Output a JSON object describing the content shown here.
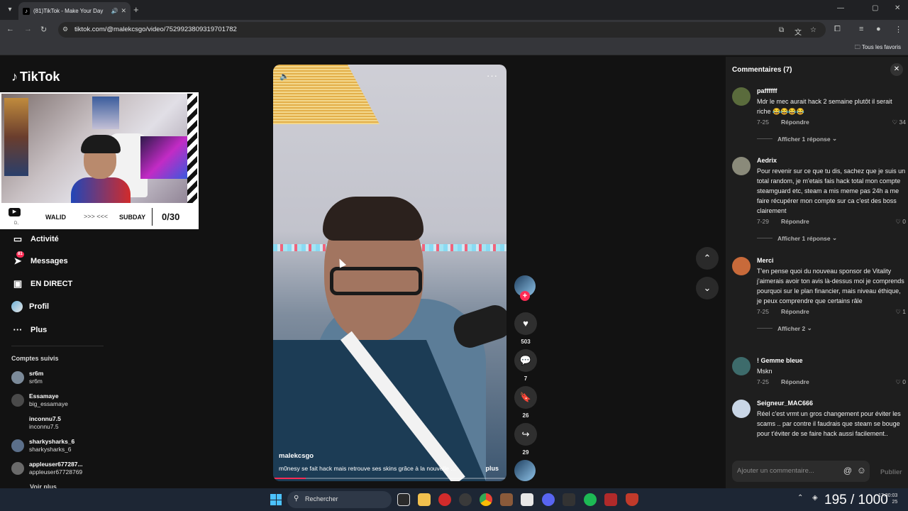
{
  "browser": {
    "tab_title": "(81)TikTok - Make Your Day",
    "url": "tiktok.com/@malekcsgo/video/7529923809319701782",
    "bookmarks_folder": "Tous les favoris"
  },
  "sidebar": {
    "logo": "TikTok",
    "webcam": {
      "player1": "WALID",
      "arrows": ">>> <<<",
      "player2": "SUBDAY",
      "score": "0/30",
      "tiny": "D,"
    },
    "nav": [
      {
        "label": "Activité",
        "icon": "message-box-icon"
      },
      {
        "label": "Messages",
        "icon": "send-icon",
        "badge": "81"
      },
      {
        "label": "EN DIRECT",
        "icon": "live-tv-icon"
      },
      {
        "label": "Profil",
        "icon": "profile-avatar"
      },
      {
        "label": "Plus",
        "icon": "more-dots-icon"
      }
    ],
    "followed_title": "Comptes suivis",
    "accounts": [
      {
        "name": "sr6m",
        "handle": "sr6m",
        "color": "#7b8a99"
      },
      {
        "name": "Essamaye",
        "handle": "big_essamaye",
        "color": "#4a4a4a"
      },
      {
        "name": "inconnu7.5",
        "handle": "inconnu7.5",
        "color": "#121212"
      },
      {
        "name": "sharkysharks_6",
        "handle": "sharkysharks_6",
        "color": "#5b6f8a"
      },
      {
        "name": "appleuser677287...",
        "handle": "appleuser67728769",
        "color": "#6a6a6a"
      }
    ],
    "see_more": "Voir plus"
  },
  "video": {
    "author": "malekcsgo",
    "caption": "m0nesy se fait hack mais retrouve ses skins grâce à la nouvelle ...",
    "more_label": "plus",
    "progress": 0.14,
    "actions": {
      "likes": "503",
      "comments": "7",
      "saves": "26",
      "shares": "29"
    }
  },
  "comments": {
    "title": "Commentaires (7)",
    "items": [
      {
        "user": "paffffff",
        "text": "Mdr le mec aurait hack 2 semaine plutôt il serait riche 😂😂😂😂",
        "date": "7-25",
        "reply": "Répondre",
        "likes": "34",
        "replies": "Afficher 1 réponse",
        "color": "#5a6b3c"
      },
      {
        "user": "Aedrix",
        "text": "Pour revenir sur ce que tu dis, sachez que je suis un total random, je m'etais fais hack total mon compte steamguard etc, steam a mis meme pas 24h a me faire récupérer mon compte sur ca c'est des boss clairement",
        "date": "7-29",
        "reply": "Répondre",
        "likes": "0",
        "replies": "Afficher 1 réponse",
        "color": "#8a8a7a"
      },
      {
        "user": "Merci",
        "text": "T'en pense quoi du nouveau sponsor de Vitality j'aimerais avoir ton avis là-dessus moi je comprends pourquoi sur le plan financier, mais niveau éthique, je peux comprendre que certains râle",
        "date": "7-25",
        "reply": "Répondre",
        "likes": "1",
        "replies": "Afficher 2",
        "color": "#c86a3a"
      },
      {
        "user": "! Gemme bleue",
        "text": "Mskn",
        "date": "7-25",
        "reply": "Répondre",
        "likes": "0",
        "replies": "",
        "color": "#3d6b6b"
      },
      {
        "user": "Seigneur_MAC666",
        "text": "Réel c'est vrmt un gros changement pour éviter les scams .. par contre il faudrais que steam se bouge pour t'éviter de se faire hack aussi facilement..",
        "date": "7-25",
        "reply": "Répondre",
        "likes": "0",
        "replies": "",
        "color": "#c9d6e6"
      }
    ],
    "input_placeholder": "Ajouter un commentaire...",
    "publish": "Publier"
  },
  "taskbar": {
    "search": "Rechercher",
    "time": "17:30:03",
    "date": "25",
    "overlay": "195 / 1000"
  }
}
